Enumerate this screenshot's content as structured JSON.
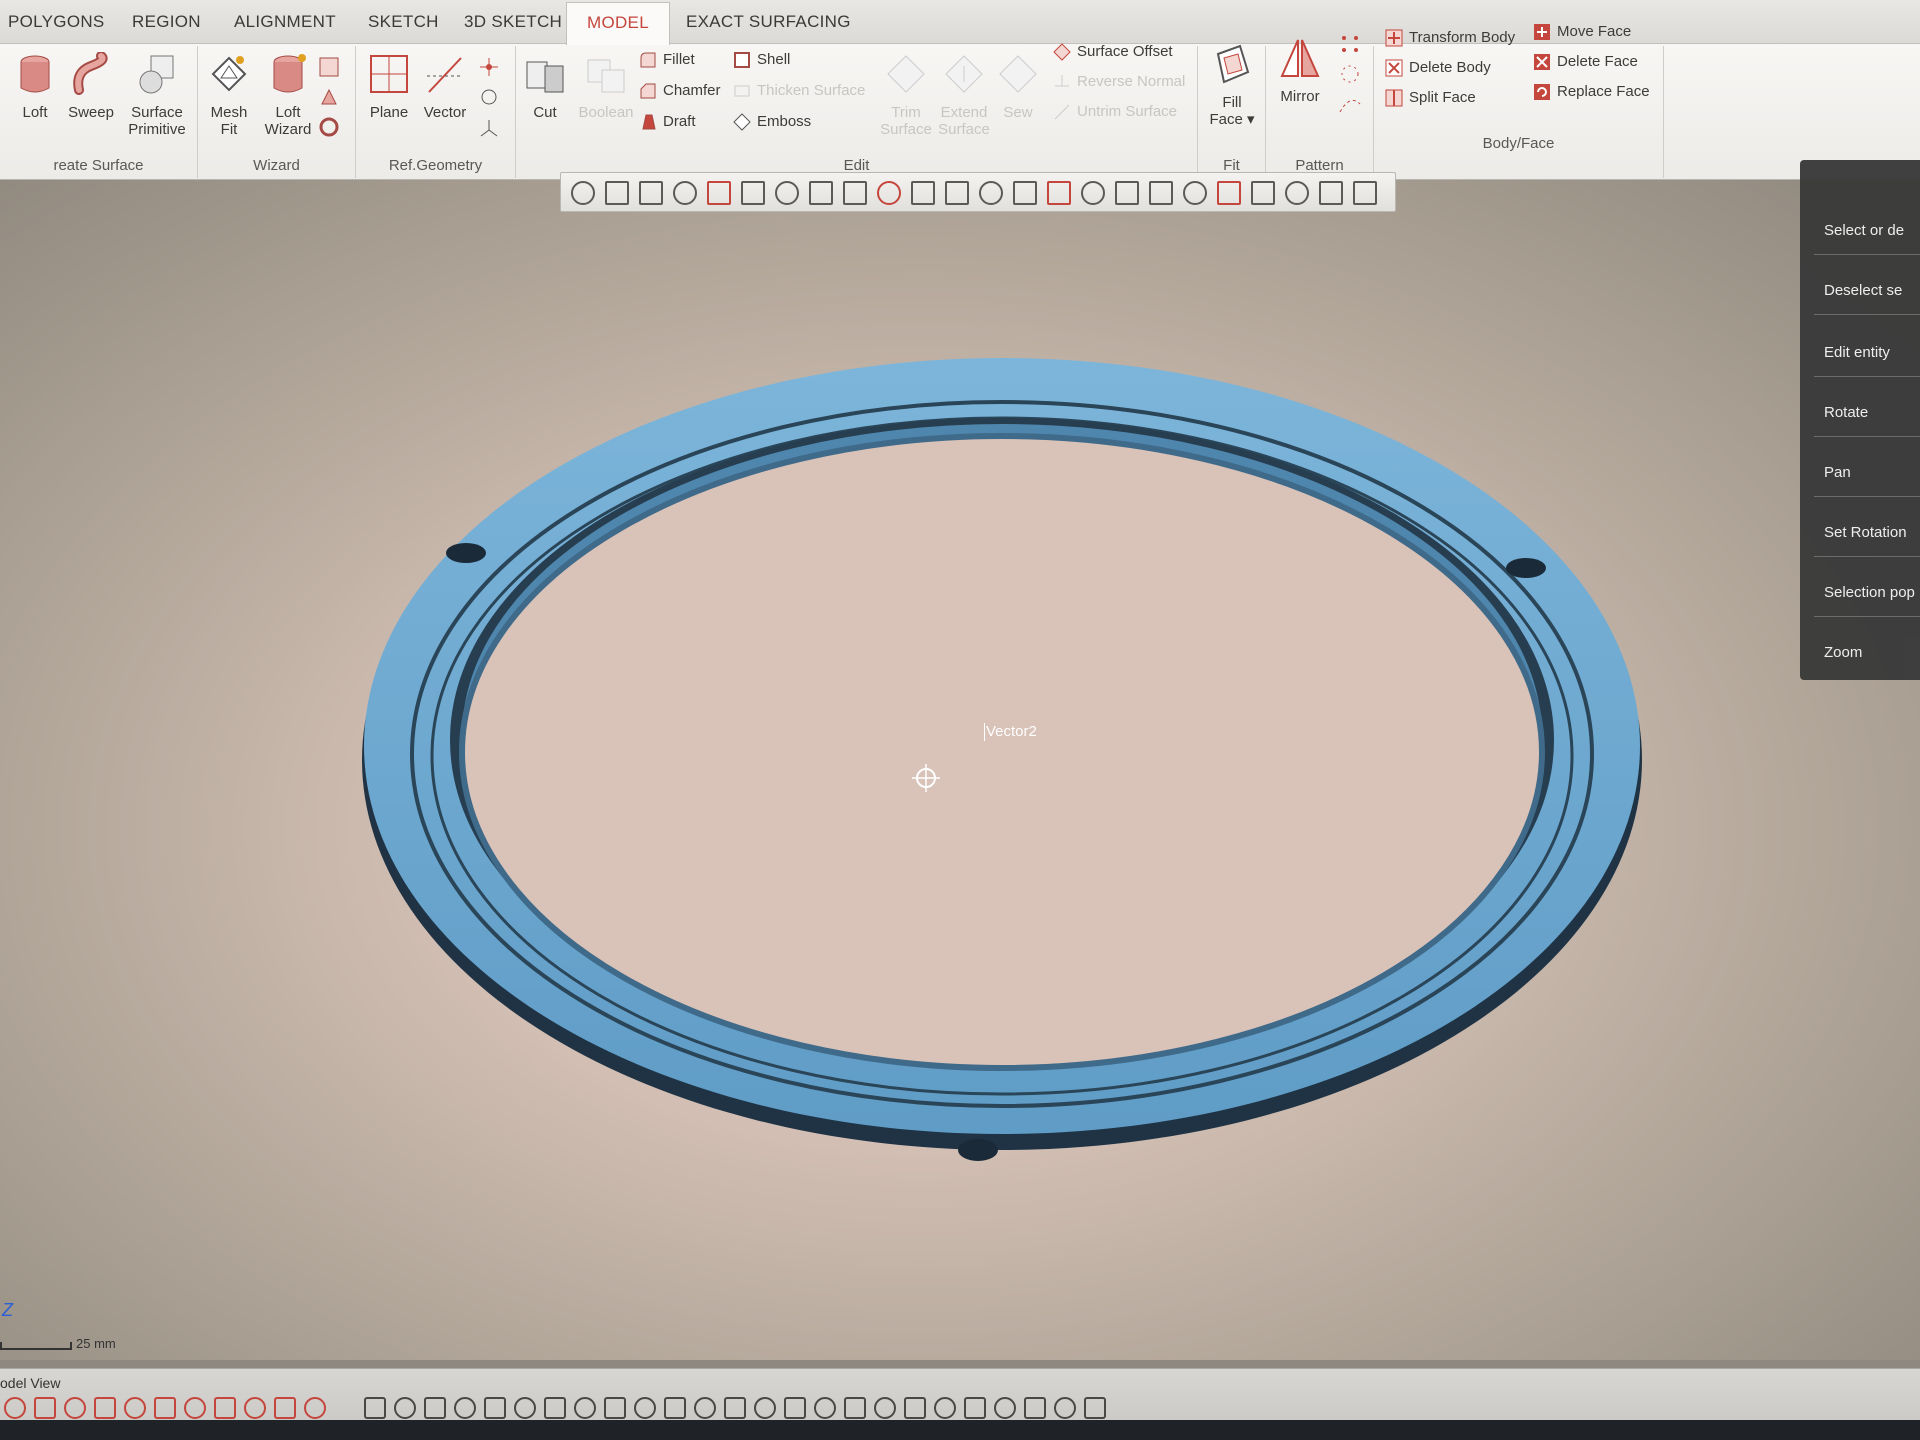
{
  "tabs": [
    {
      "label": "POLYGONS"
    },
    {
      "label": "REGION"
    },
    {
      "label": "ALIGNMENT"
    },
    {
      "label": "SKETCH"
    },
    {
      "label": "3D SKETCH"
    },
    {
      "label": "MODEL",
      "active": true
    },
    {
      "label": "EXACT SURFACING"
    }
  ],
  "groups": {
    "create_surface": {
      "label": "reate Surface",
      "tools": {
        "loft": "Loft",
        "sweep": "Sweep",
        "surface_primitive": "Surface Primitive"
      }
    },
    "wizard": {
      "label": "Wizard",
      "tools": {
        "mesh_fit": "Mesh Fit",
        "loft_wizard": "Loft Wizard"
      }
    },
    "ref_geometry": {
      "label": "Ref.Geometry",
      "tools": {
        "plane": "Plane",
        "vector": "Vector"
      }
    },
    "edit": {
      "label": "Edit",
      "tools": {
        "cut": "Cut",
        "boolean": "Boolean",
        "fillet": "Fillet",
        "chamfer": "Chamfer",
        "draft": "Draft",
        "shell": "Shell",
        "thicken_surface": "Thicken Surface",
        "emboss": "Emboss",
        "trim_surface": "Trim Surface",
        "extend_surface": "Extend Surface",
        "sew": "Sew",
        "surface_offset": "Surface Offset",
        "reverse_normal": "Reverse Normal",
        "untrim_surface": "Untrim Surface"
      }
    },
    "fit": {
      "label": "Fit",
      "tools": {
        "fill_face": "Fill Face"
      }
    },
    "pattern": {
      "label": "Pattern",
      "tools": {
        "mirror": "Mirror"
      }
    },
    "body_face": {
      "label": "Body/Face",
      "tools": {
        "transform_body": "Transform Body",
        "delete_body": "Delete Body",
        "split_face": "Split Face",
        "move_face": "Move Face",
        "delete_face": "Delete Face",
        "replace_face": "Replace Face"
      }
    }
  },
  "viewport": {
    "label": "Vector2",
    "ring_color": "#6fa8cf",
    "ring_shadow": "#2c4356"
  },
  "context_menu": {
    "items": [
      "Select or de",
      "Deselect se",
      "Edit entity",
      "Rotate",
      "Pan",
      "Set Rotation",
      "Selection pop",
      "Zoom"
    ]
  },
  "status": {
    "scale": "25 mm",
    "axis": "Z",
    "view_tab": "odel View"
  },
  "colors": {
    "accent": "#c4463c",
    "ribbon_bg": "#f5f4f2",
    "menu_bg": "#3a3a3a"
  }
}
